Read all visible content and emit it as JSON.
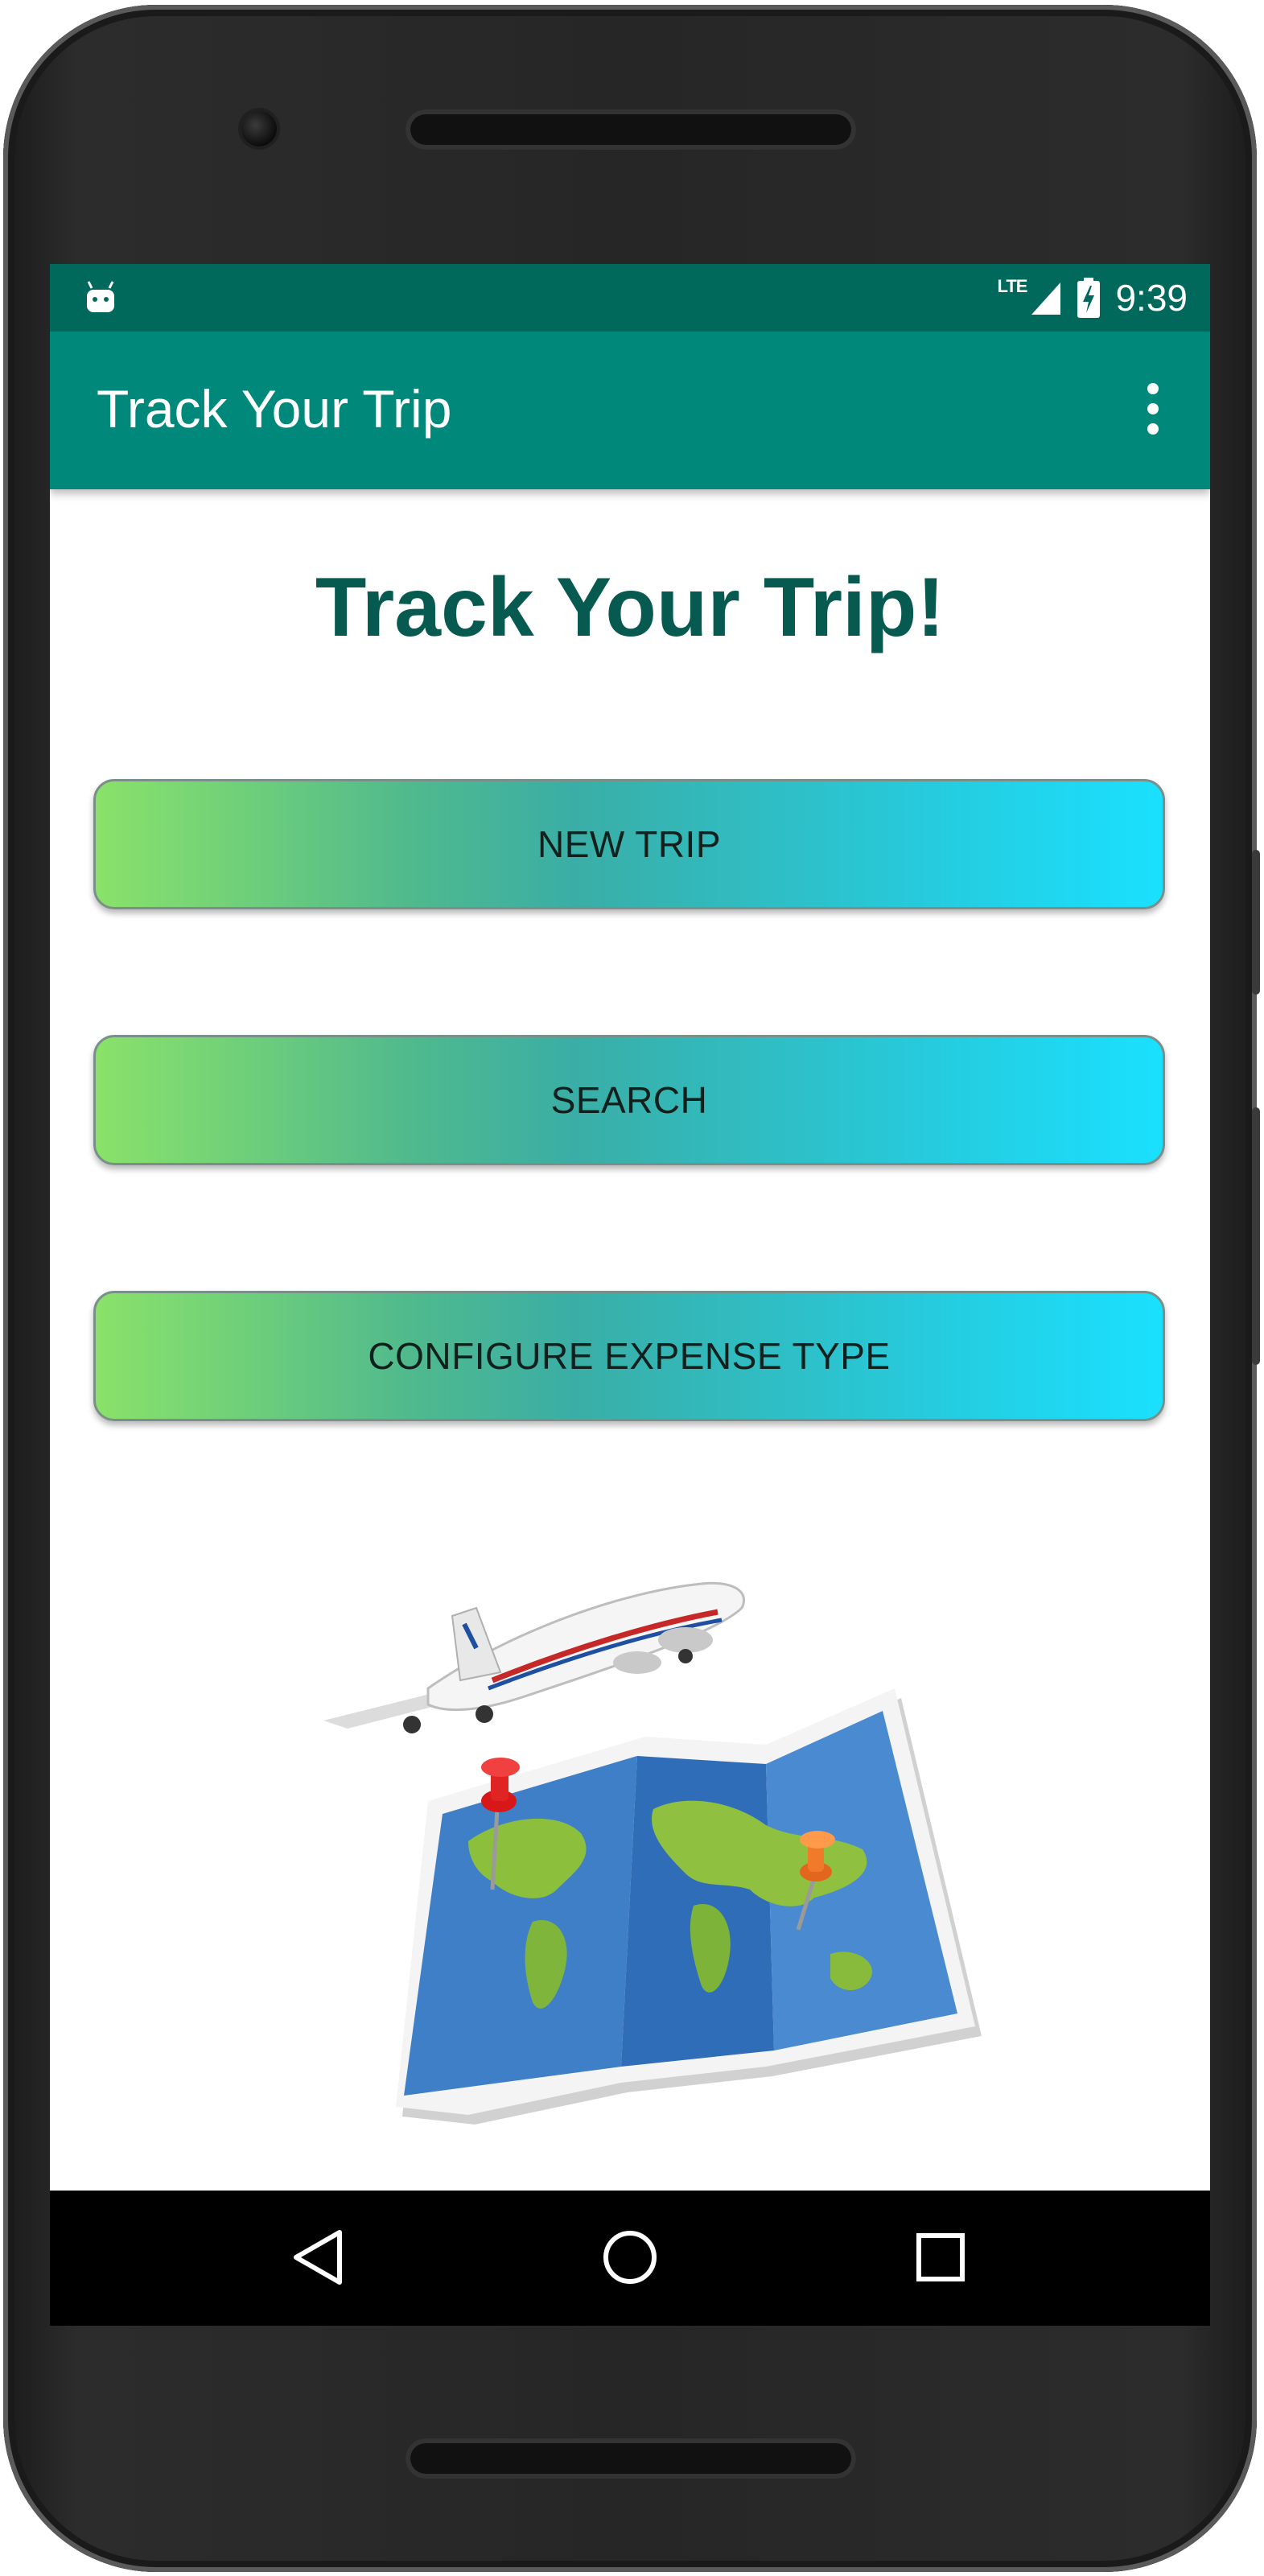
{
  "statusbar": {
    "network_label": "LTE",
    "time": "9:39",
    "icons": [
      "android-notification-icon",
      "signal-icon",
      "battery-charging-icon"
    ]
  },
  "appbar": {
    "title": "Track Your Trip",
    "overflow_icon": "more-vert-icon"
  },
  "main": {
    "headline": "Track Your Trip!",
    "buttons": [
      {
        "label": "NEW TRIP"
      },
      {
        "label": "SEARCH"
      },
      {
        "label": "CONFIGURE EXPENSE TYPE"
      }
    ],
    "illustration": "airplane-over-world-map"
  },
  "navbar": {
    "icons": [
      "back-icon",
      "home-icon",
      "recents-icon"
    ]
  },
  "colors": {
    "status_bar": "#00695c",
    "app_bar": "#00897b",
    "headline": "#075a50",
    "button_gradient_start": "#8ae269",
    "button_gradient_end": "#1ae0ff"
  }
}
